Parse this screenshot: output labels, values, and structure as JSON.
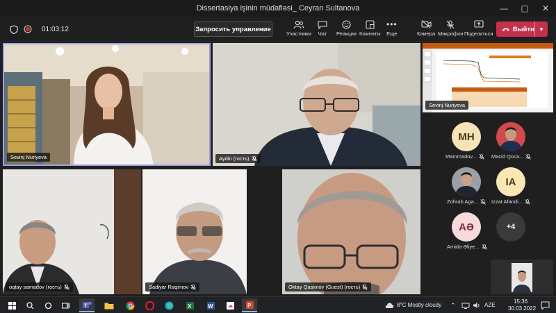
{
  "window": {
    "title": "Dissertasiya işinin müdafiəsi_ Ceyran Sultanova"
  },
  "toolbar": {
    "timer": "01:03:12",
    "request_control": "Запросить управление",
    "participants": "Участники",
    "chat": "Чат",
    "reactions": "Реакции",
    "rooms": "Комнаты",
    "more": "Еще",
    "camera": "Камера",
    "mic": "Микрофон",
    "share": "Поделиться",
    "leave": "Выйти"
  },
  "tiles": [
    {
      "name": "Sevinj Nuriyeva"
    },
    {
      "name": "Aydin (гость)"
    },
    {
      "name": "Sevinj Nuriyeva"
    },
    {
      "name": "oqtay samadov (гость)"
    },
    {
      "name": "Sadiyar Raqimov"
    },
    {
      "name": "Oktay Qasimov (Guest) (гость)"
    }
  ],
  "participants": [
    {
      "initials": "MH",
      "name": "Mammadov...",
      "color": "#f6e3b6",
      "text_color": "#4a3c1a"
    },
    {
      "initials": "",
      "name": "Macid Qoca...",
      "color": "#3b4a66",
      "text_color": "#fff"
    },
    {
      "initials": "",
      "name": "Zohrab Aga...",
      "color": "#6a6a6a",
      "text_color": "#fff"
    },
    {
      "initials": "IA",
      "name": "Izzat Afandi...",
      "color": "#fbe7b3",
      "text_color": "#4a3c1a"
    },
    {
      "initials": "AƏ",
      "name": "Amida Əliye...",
      "color": "#f8dadc",
      "text_color": "#7a2a35"
    },
    {
      "initials": "+4",
      "name": "",
      "color": "#3a3a3a",
      "text_color": "#fff"
    }
  ],
  "taskbar": {
    "time": "15:36",
    "date": "30.03.2022",
    "weather": "8°C  Mostly cloudy",
    "lang": "AZE"
  },
  "colors": {
    "leave": "#c4314b",
    "active_border": "#a3a0e8"
  }
}
